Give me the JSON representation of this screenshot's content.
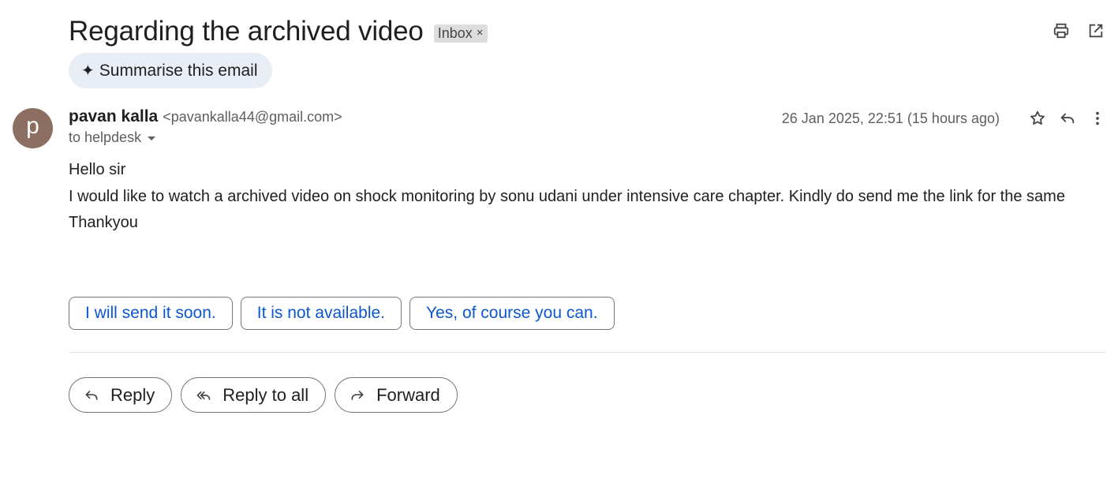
{
  "email": {
    "subject": "Regarding the archived video",
    "label": "Inbox",
    "label_close": "×",
    "summarise_label": "Summarise this email",
    "sender": {
      "avatar_letter": "p",
      "name": "pavan kalla",
      "email": "<pavankalla44@gmail.com>",
      "to": "to helpdesk"
    },
    "date": "26 Jan 2025, 22:51 (15 hours ago)",
    "body": {
      "greeting": "Hello sir",
      "message": "I would like to watch a archived video on shock monitoring by sonu udani under intensive care chapter. Kindly do send me the link for the same",
      "closing": "Thankyou"
    }
  },
  "smart_replies": [
    "I will send it soon.",
    "It is not available.",
    "Yes, of course you can."
  ],
  "actions": {
    "reply": "Reply",
    "reply_all": "Reply to all",
    "forward": "Forward"
  },
  "icons": {
    "print": "print-icon",
    "open_new_window": "open-in-new-window-icon",
    "star": "star-icon",
    "reply": "reply-icon",
    "more": "more-vertical-icon",
    "reply_all": "reply-all-icon",
    "forward": "forward-icon",
    "spark": "sparkle-icon"
  },
  "colors": {
    "avatar_bg": "#8d6e63",
    "smart_reply_text": "#0b57d0",
    "summarise_bg": "#e9eef6",
    "label_bg": "#dddddd"
  }
}
